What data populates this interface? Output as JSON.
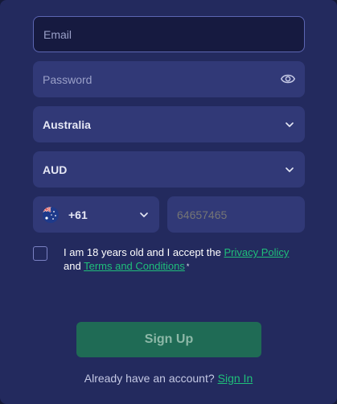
{
  "form": {
    "email": {
      "placeholder": "Email",
      "value": ""
    },
    "password": {
      "placeholder": "Password",
      "value": ""
    },
    "country": {
      "selected": "Australia"
    },
    "currency": {
      "selected": "AUD"
    },
    "phone": {
      "code": "+61",
      "flag": "australia-flag-icon",
      "placeholder": "64657465"
    },
    "consent": {
      "text_before": "I am 18 years old and I accept the",
      "privacy_link": "Privacy Policy",
      "text_and": "and",
      "terms_link": "Terms and Conditions",
      "required_mark": "*",
      "checked": false
    },
    "signup_label": "Sign Up",
    "footer": {
      "text": "Already have an account?",
      "signin_link": "Sign In"
    }
  },
  "colors": {
    "background": "#232a5e",
    "field": "#313977",
    "accent": "#1fbf7a",
    "button": "#1f6b55"
  },
  "icons": {
    "password_toggle": "eye-icon",
    "dropdown": "chevron-down-icon"
  }
}
